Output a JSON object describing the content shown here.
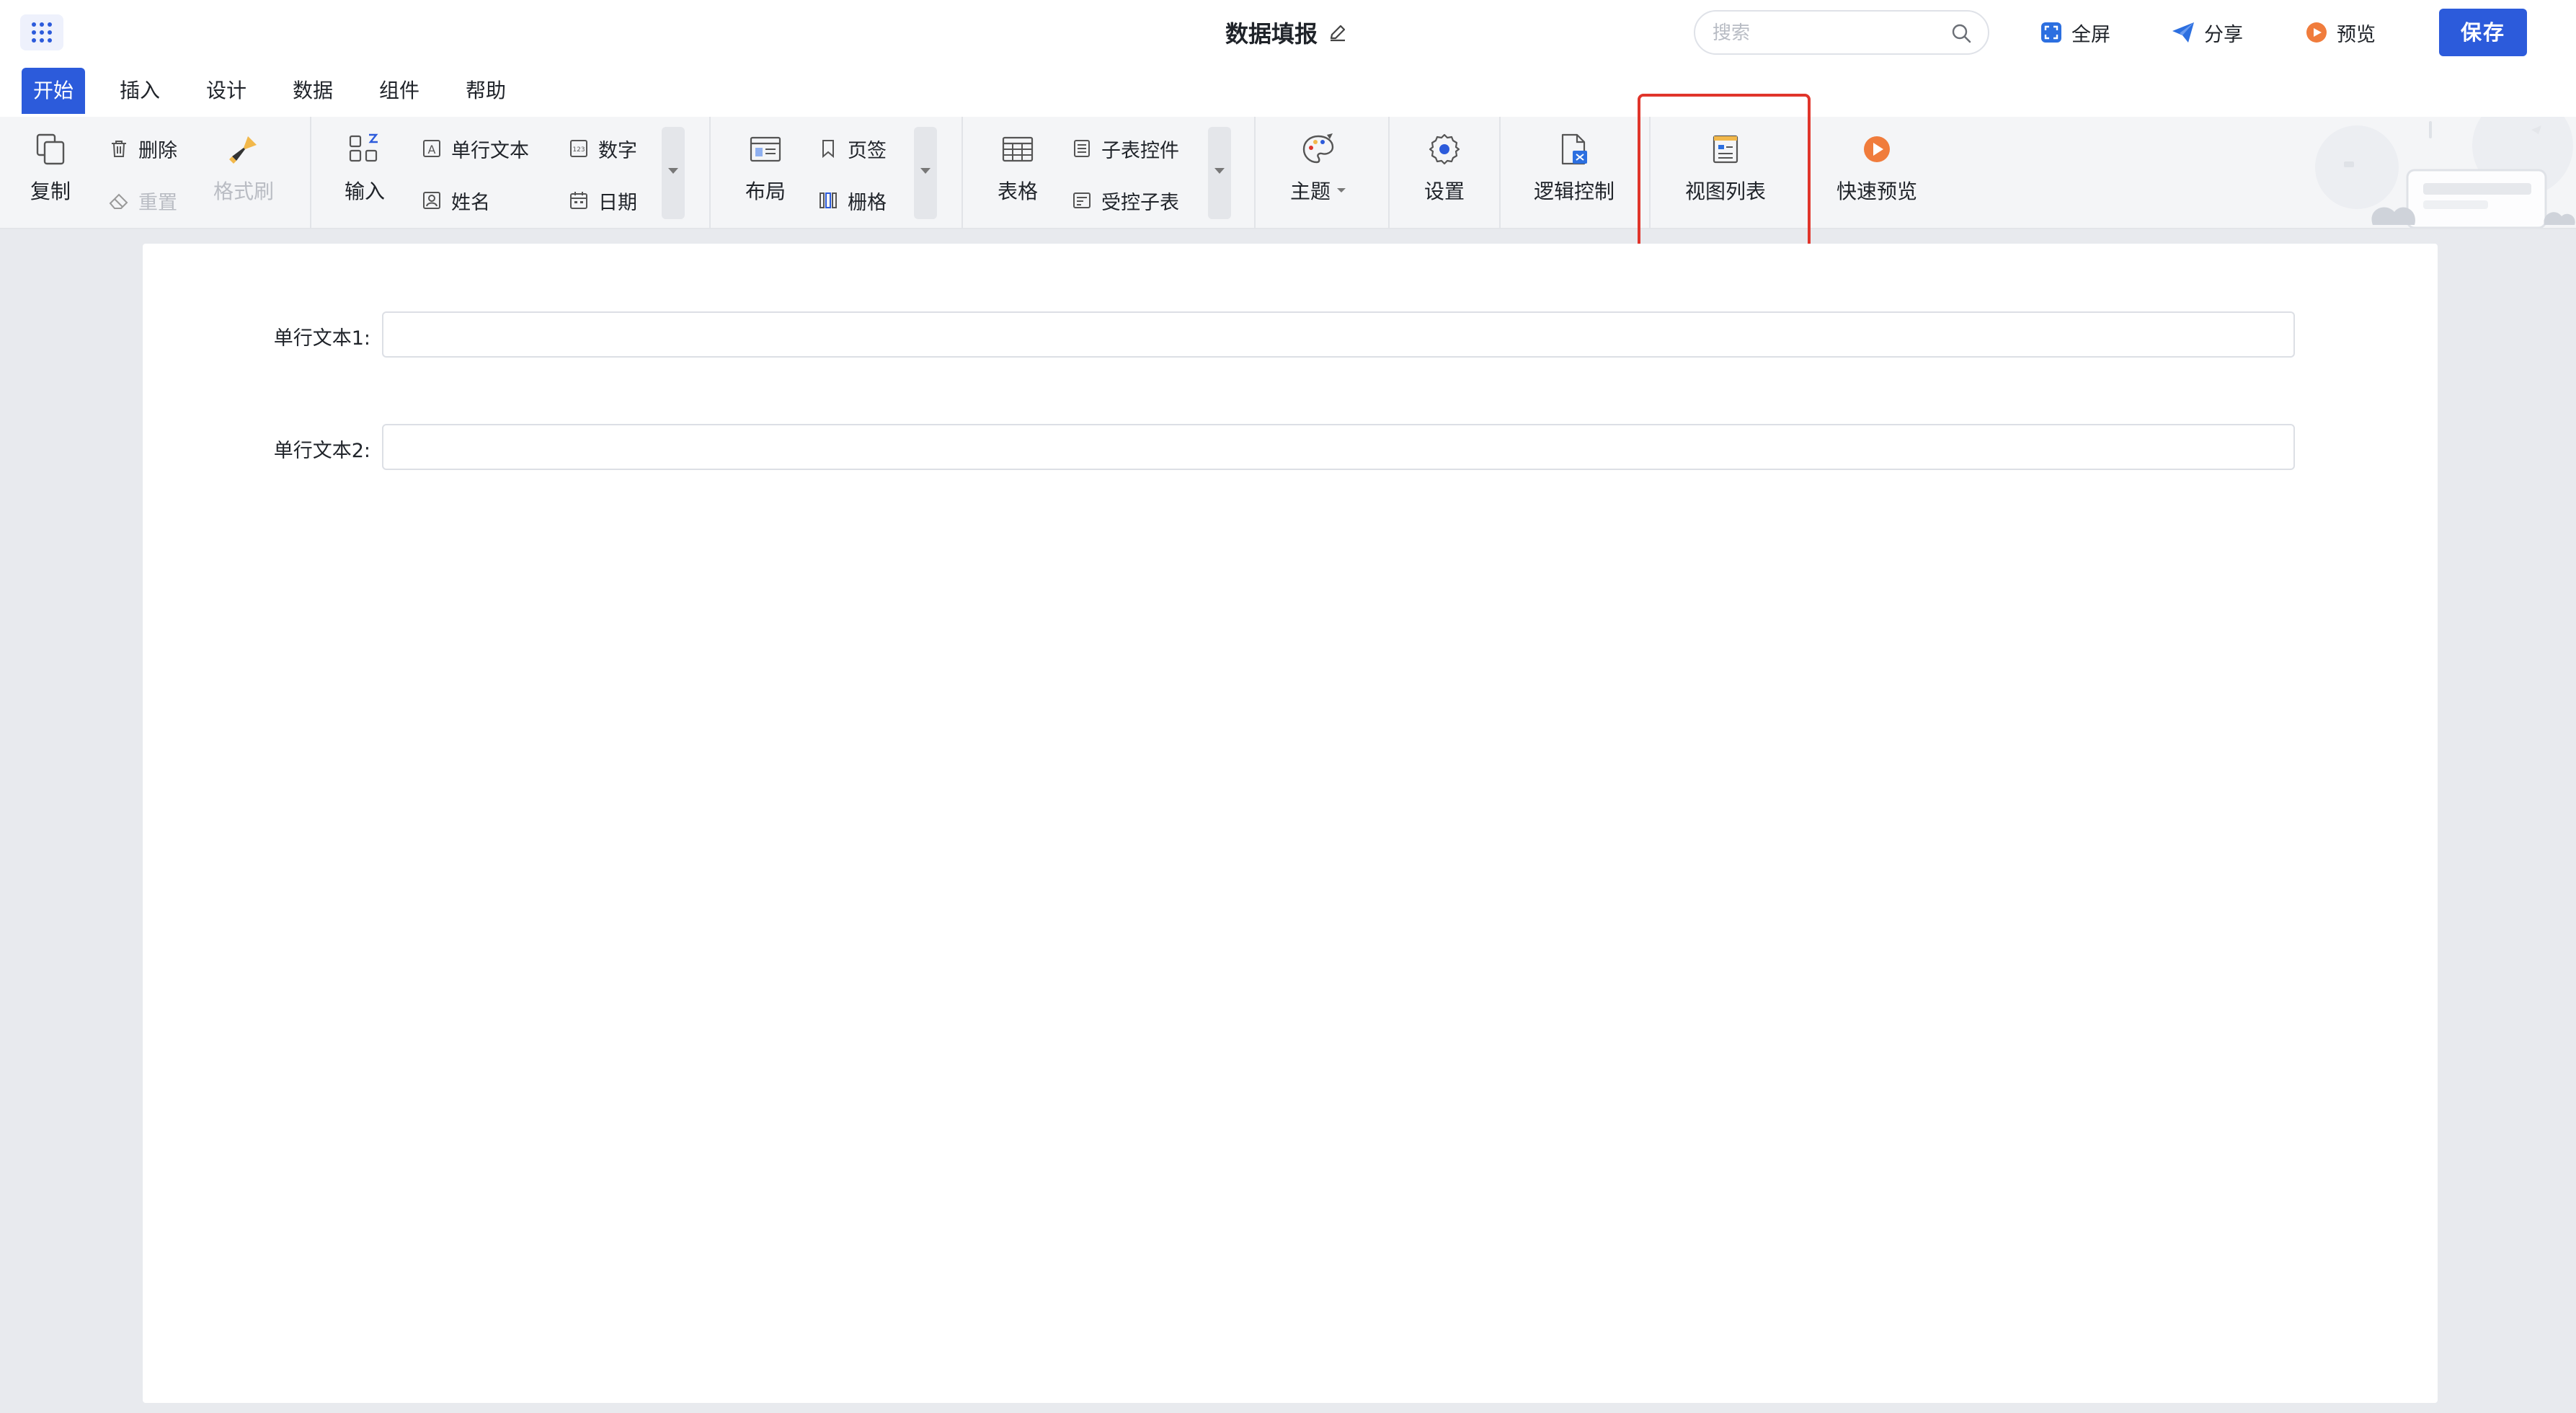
{
  "header": {
    "title": "数据填报",
    "search_placeholder": "搜索",
    "fullscreen_label": "全屏",
    "share_label": "分享",
    "preview_label": "预览",
    "save_label": "保存"
  },
  "tabs": [
    "开始",
    "插入",
    "设计",
    "数据",
    "组件",
    "帮助"
  ],
  "ribbon": {
    "copy": "复制",
    "delete": "删除",
    "reset": "重置",
    "format_brush": "格式刷",
    "input": "输入",
    "single_line_text": "单行文本",
    "name": "姓名",
    "number": "数字",
    "date": "日期",
    "layout": "布局",
    "tab_page": "页签",
    "grid": "栅格",
    "table": "表格",
    "subtable_control": "子表控件",
    "controlled_subtable": "受控子表",
    "theme": "主题",
    "settings": "设置",
    "logic_control": "逻辑控制",
    "view_list": "视图列表",
    "quick_preview": "快速预览"
  },
  "form": {
    "fields": [
      {
        "label": "单行文本1:",
        "value": ""
      },
      {
        "label": "单行文本2:",
        "value": ""
      }
    ]
  },
  "colors": {
    "primary": "#2c5bdb",
    "highlight": "#e0352b",
    "preview_orange": "#f07c3c",
    "ribbon_bg": "#f4f5f7"
  }
}
